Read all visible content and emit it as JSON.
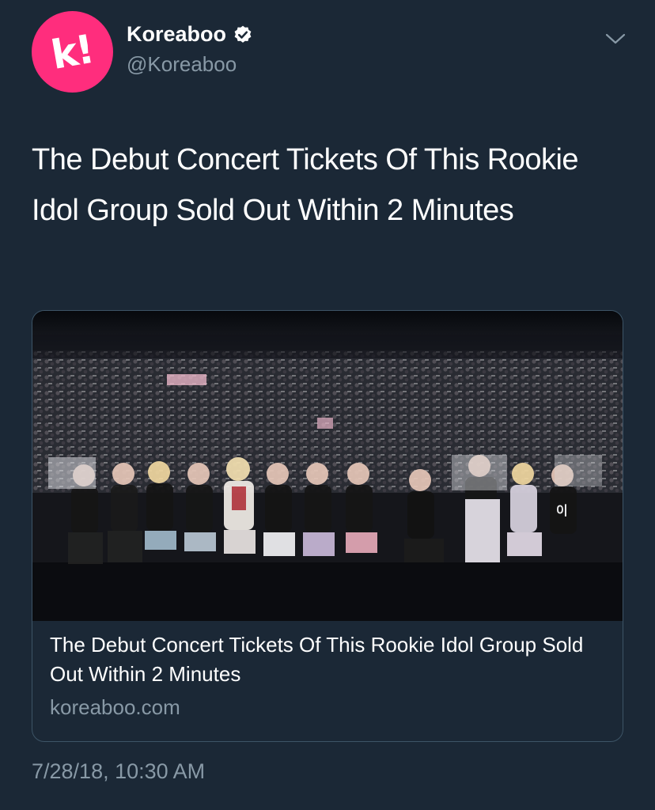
{
  "author": {
    "display_name": "Koreaboo",
    "handle": "@Koreaboo",
    "avatar_letter": "k!",
    "verified": true,
    "avatar_color": "#ff2d7d"
  },
  "tweet": {
    "text": "The Debut Concert Tickets Of This Rookie Idol Group Sold Out Within 2 Minutes",
    "timestamp": "7/28/18, 10:30 AM"
  },
  "card": {
    "image_icon": "concert-photo",
    "title": "The Debut Concert Tickets Of This Rookie Idol Group Sold Out Within 2 Minutes",
    "domain": "koreaboo.com"
  },
  "menu_icon": "chevron-down-icon",
  "colors": {
    "background": "#1b2836",
    "secondary_text": "#8899a6",
    "card_border": "#3d5466"
  }
}
